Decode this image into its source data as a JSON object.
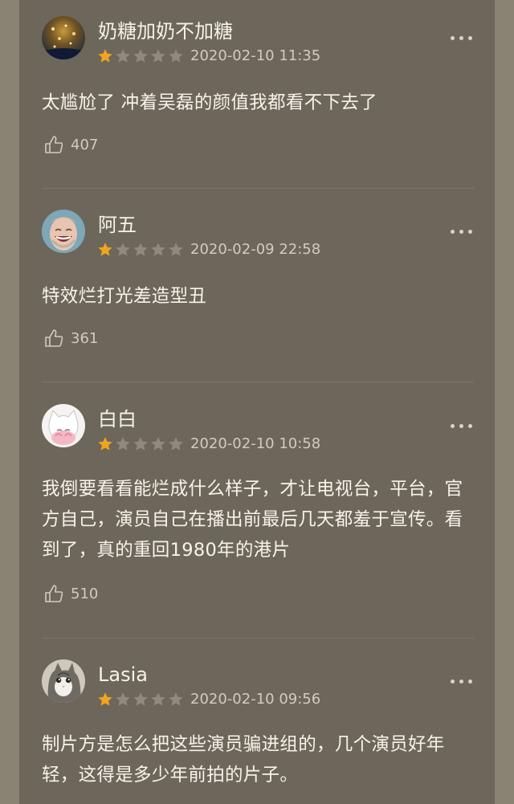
{
  "colors": {
    "background": "#6d665b",
    "side_margin": "#8a8373",
    "star_filled": "#f1a41f",
    "star_empty": "#8f897f",
    "text_primary": "#f7f3eb",
    "text_secondary": "#d1cbc1"
  },
  "comments": [
    {
      "username": "奶糖加奶不加糖",
      "rating": 1,
      "max_rating": 5,
      "date": "2020-02-10 11:35",
      "text": "太尴尬了 冲着吴磊的颜值我都看不下去了",
      "likes": "407",
      "avatar_icon": "night-sky-avatar-icon"
    },
    {
      "username": "阿五",
      "rating": 1,
      "max_rating": 5,
      "date": "2020-02-09 22:58",
      "text": "特效烂打光差造型丑",
      "likes": "361",
      "avatar_icon": "laughing-man-avatar-icon"
    },
    {
      "username": "白白",
      "rating": 1,
      "max_rating": 5,
      "date": "2020-02-10 10:58",
      "text": "我倒要看看能烂成什么样子，才让电视台，平台，官方自己，演员自己在播出前最后几天都羞于宣传。看到了，真的重回1980年的港片",
      "likes": "510",
      "avatar_icon": "cartoon-cat-avatar-icon"
    },
    {
      "username": "Lasia",
      "rating": 1,
      "max_rating": 5,
      "date": "2020-02-10 09:56",
      "text": "制片方是怎么把这些演员骗进组的，几个演员好年轻，这得是多少年前拍的片子。",
      "likes": "",
      "avatar_icon": "cat-photo-avatar-icon"
    }
  ],
  "icons": {
    "more": "more-options-icon",
    "like": "thumbs-up-icon",
    "star": "star-icon"
  }
}
